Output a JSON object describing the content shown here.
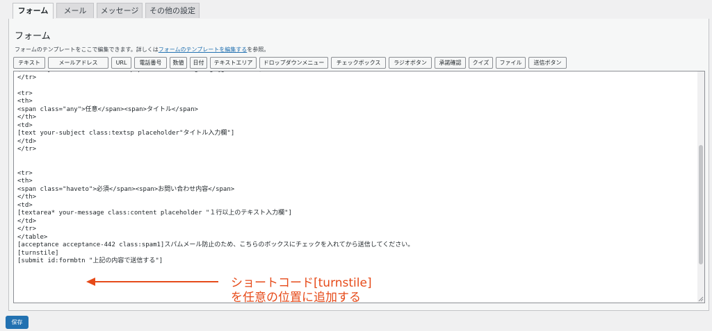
{
  "tabs": [
    {
      "label": "フォーム",
      "active": true
    },
    {
      "label": "メール",
      "active": false
    },
    {
      "label": "メッセージ",
      "active": false
    },
    {
      "label": "その他の設定",
      "active": false
    }
  ],
  "panel": {
    "title": "フォーム",
    "desc_before": "フォームのテンプレートをここで編集できます。詳しくは",
    "desc_link": "フォームのテンプレートを編集する",
    "desc_after": "を参照。"
  },
  "tag_buttons": [
    "テキスト",
    "メールアドレス",
    "URL",
    "電話番号",
    "数値",
    "日付",
    "テキストエリア",
    "ドロップダウンメニュー",
    "チェックボックス",
    "ラジオボタン",
    "承諾確認",
    "クイズ",
    "ファイル",
    "送信ボタン"
  ],
  "editor": {
    "lines": [
      "[email* your-email class:mailsp placeholder \"hogehoge@gmail.com\"]</td>",
      "</tr>",
      "",
      "<tr>",
      "<th>",
      "<span class=\"any\">任意</span><span>タイトル</span>",
      "</th>",
      "<td>",
      "[text your-subject class:textsp placeholder\"タイトル入力欄\"]",
      "</td>",
      "</tr>",
      "",
      "",
      "<tr>",
      "<th>",
      "<span class=\"haveto\">必須</span><span>お問い合わせ内容</span>",
      "</th>",
      "<td>",
      "[textarea* your-message class:content placeholder \"１行以上のテキスト入力欄\"]",
      "</td>",
      "</tr>",
      "</table>",
      "[acceptance acceptance-442 class:spam1]スパムメール防止のため、こちらのボックスにチェックを入れてから送信してください。",
      "[turnstile]",
      "[submit id:formbtn \"上記の内容で送信する\"]"
    ]
  },
  "annotation": {
    "line1": "ショートコード[turnstile]",
    "line2": "を任意の位置に追加する",
    "color": "#e64a19"
  },
  "save_label": "保存",
  "colors": {
    "primary": "#2271b1",
    "annotation": "#e64a19"
  }
}
